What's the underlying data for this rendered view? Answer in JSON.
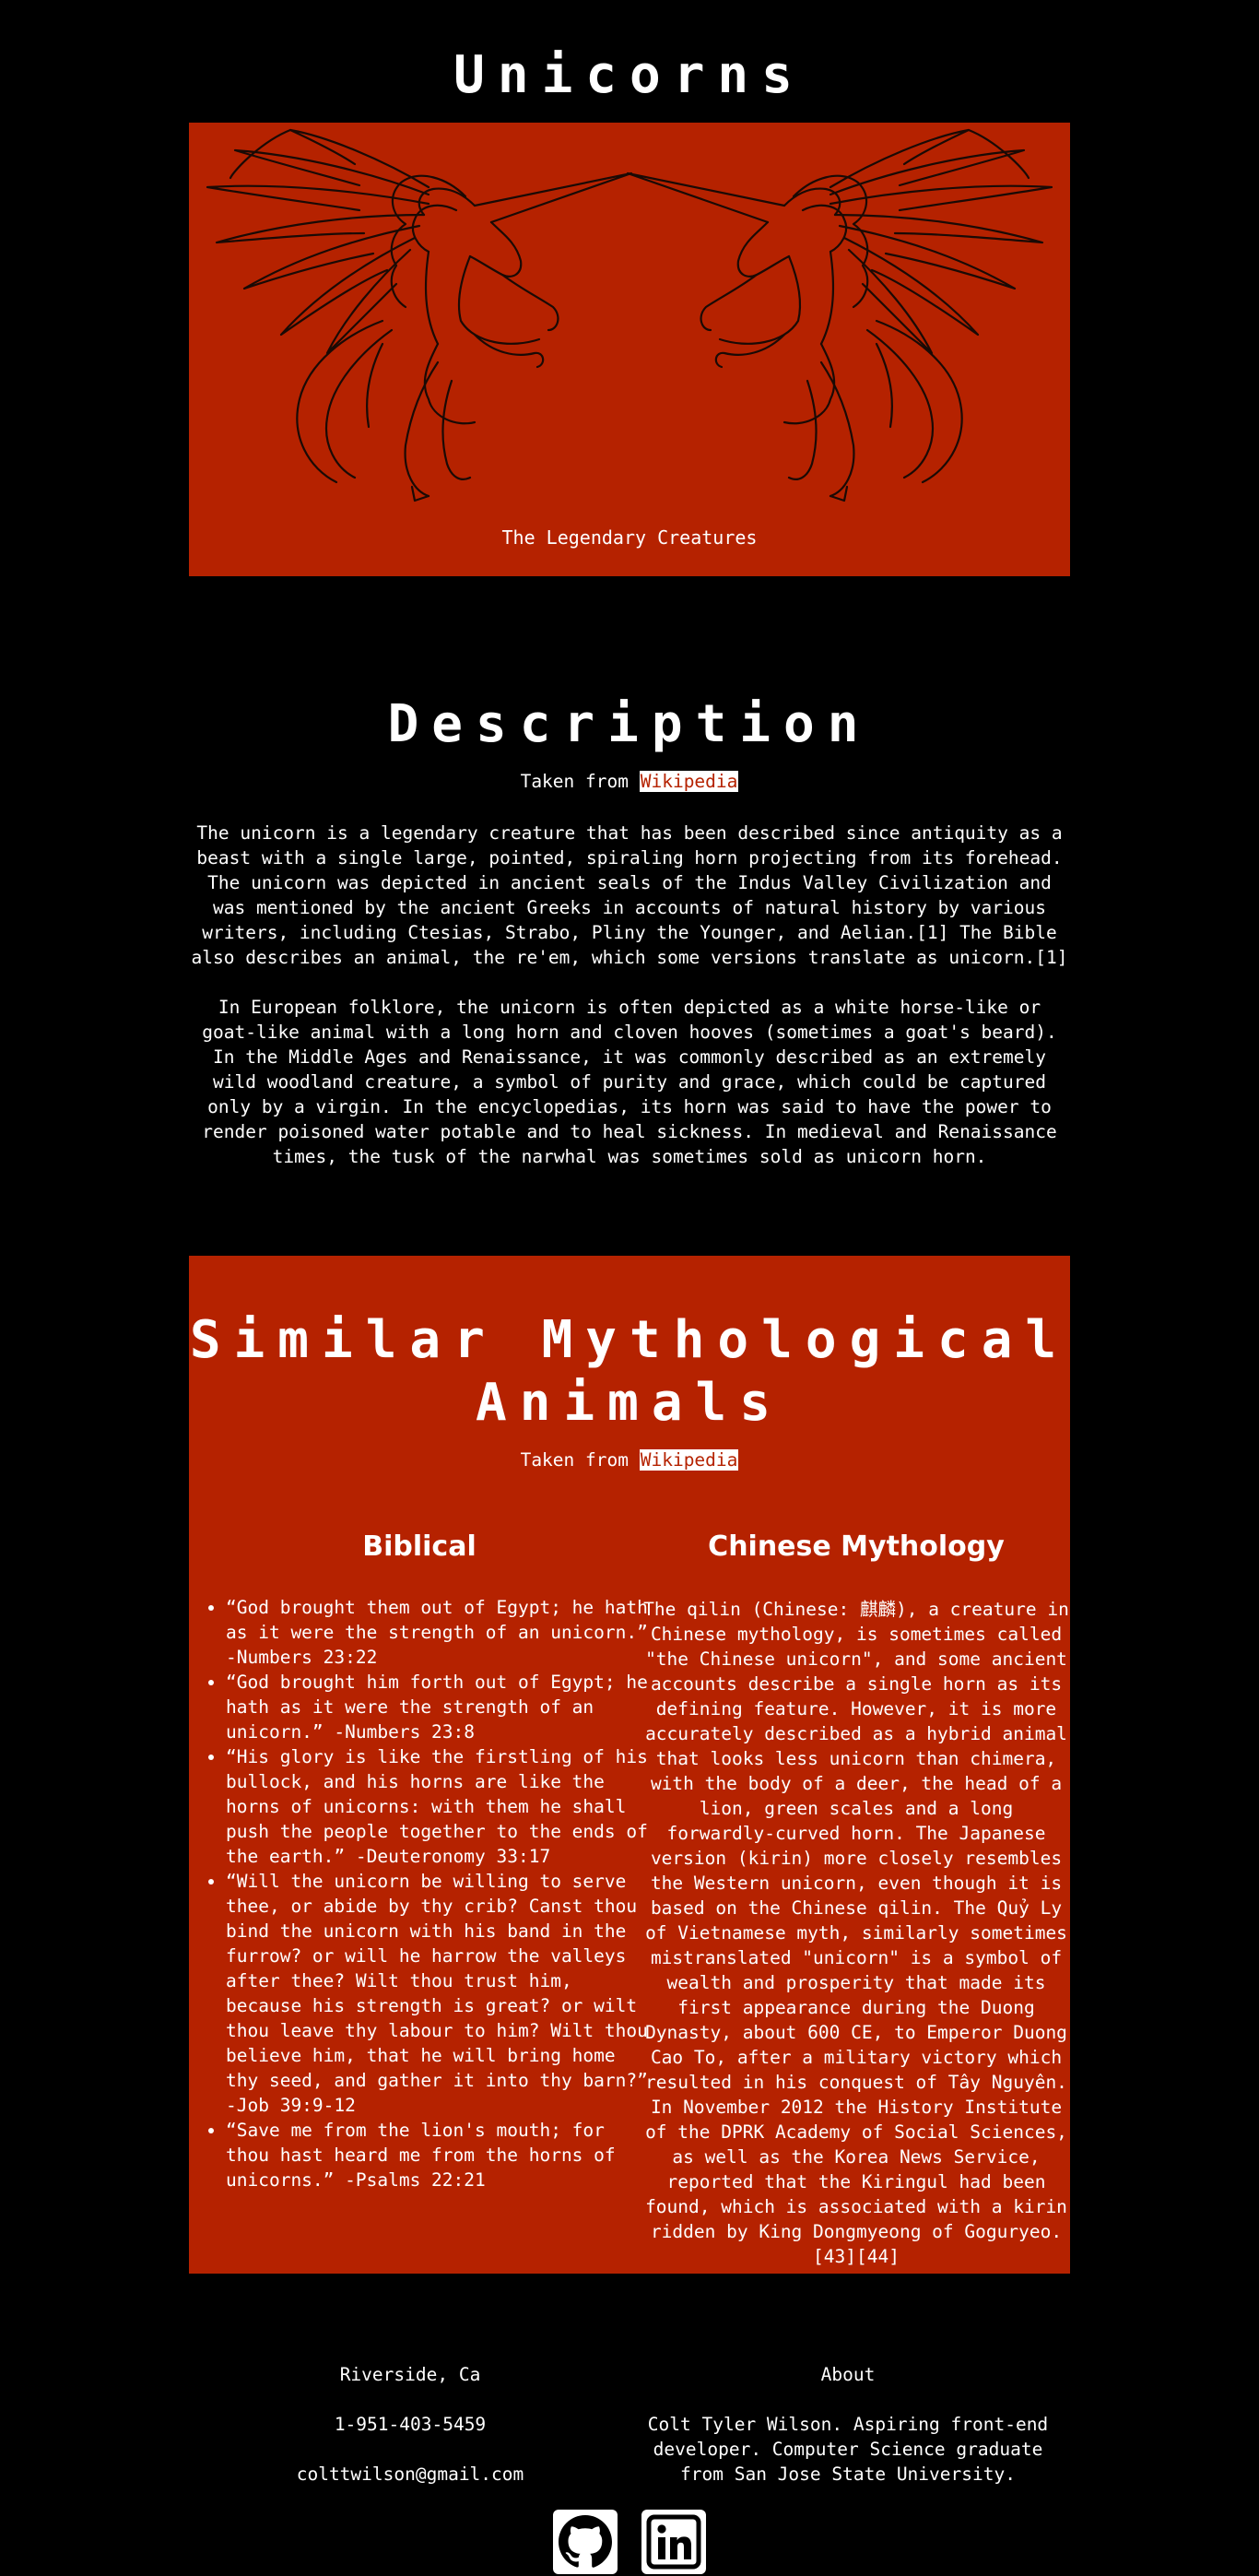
{
  "page_title": "Unicorns",
  "hero": {
    "caption": "The Legendary Creatures"
  },
  "description": {
    "title": "Description",
    "source_prefix": "Taken from",
    "source_link": "Wikipedia",
    "paragraphs": [
      "The unicorn is a legendary creature that has been described since antiquity as a beast with a single large, pointed, spiraling horn projecting from its forehead. The unicorn was depicted in ancient seals of the Indus Valley Civilization and was mentioned by the ancient Greeks in accounts of natural history by various writers, including Ctesias, Strabo, Pliny the Younger, and Aelian.[1] The Bible also describes an animal, the re'em, which some versions translate as unicorn.[1]",
      "In European folklore, the unicorn is often depicted as a white horse-like or goat-like animal with a long horn and cloven hooves (sometimes a goat's beard). In the Middle Ages and Renaissance, it was commonly described as an extremely wild woodland creature, a symbol of purity and grace, which could be captured only by a virgin. In the encyclopedias, its horn was said to have the power to render poisoned water potable and to heal sickness. In medieval and Renaissance times, the tusk of the narwhal was sometimes sold as unicorn horn."
    ]
  },
  "similar": {
    "title_line1": "Similar Mythological",
    "title_line2": "Animals",
    "source_prefix": "Taken from",
    "source_link": "Wikipedia",
    "biblical": {
      "heading": "Biblical",
      "quotes": [
        "“God brought them out of Egypt; he hath as it were the strength of an unicorn.” -Numbers 23:22",
        "“God brought him forth out of Egypt; he hath as it were the strength of an unicorn.” -Numbers 23:8",
        "“His glory is like the firstling of his bullock, and his horns are like the horns of unicorns: with them he shall push the people together to the ends of the earth.” -Deuteronomy 33:17",
        "“Will the unicorn be willing to serve thee, or abide by thy crib? Canst thou bind the unicorn with his band in the furrow? or will he harrow the valleys after thee? Wilt thou trust him, because his strength is great? or wilt thou leave thy labour to him? Wilt thou believe him, that he will bring home thy seed, and gather it into thy barn?” -Job 39:9-12",
        "“Save me from the lion's mouth; for thou hast heard me from the horns of unicorns.” -Psalms 22:21"
      ]
    },
    "chinese": {
      "heading": "Chinese Mythology",
      "text": "The qilin (Chinese: 麒麟), a creature in Chinese mythology, is sometimes called \"the Chinese unicorn\", and some ancient accounts describe a single horn as its defining feature. However, it is more accurately described as a hybrid animal that looks less unicorn than chimera, with the body of a deer, the head of a lion, green scales and a long forwardly-curved horn. The Japanese version (kirin) more closely resembles the Western unicorn, even though it is based on the Chinese qilin. The Quỷ Ly of Vietnamese myth, similarly sometimes mistranslated \"unicorn\" is a symbol of wealth and prosperity that made its first appearance during the Duong Dynasty, about 600 CE, to Emperor Duong Cao To, after a military victory which resulted in his conquest of Tây Nguyên. In November 2012 the History Institute of the DPRK Academy of Social Sciences, as well as the Korea News Service, reported that the Kiringul had been found, which is associated with a kirin ridden by King Dongmyeong of Goguryeo.[43][44]"
    }
  },
  "footer": {
    "location": "Riverside, Ca",
    "phone": "1-951-403-5459",
    "email": "colttwilson@gmail.com",
    "about_heading": "About",
    "about_text": "Colt Tyler Wilson. Aspiring front-end developer. Computer Science graduate from San Jose State University.",
    "social": [
      {
        "icon": "github-icon"
      },
      {
        "icon": "linkedin-icon"
      }
    ]
  },
  "colors": {
    "background": "#000000",
    "accent": "#b52200",
    "text": "#ffffff"
  }
}
